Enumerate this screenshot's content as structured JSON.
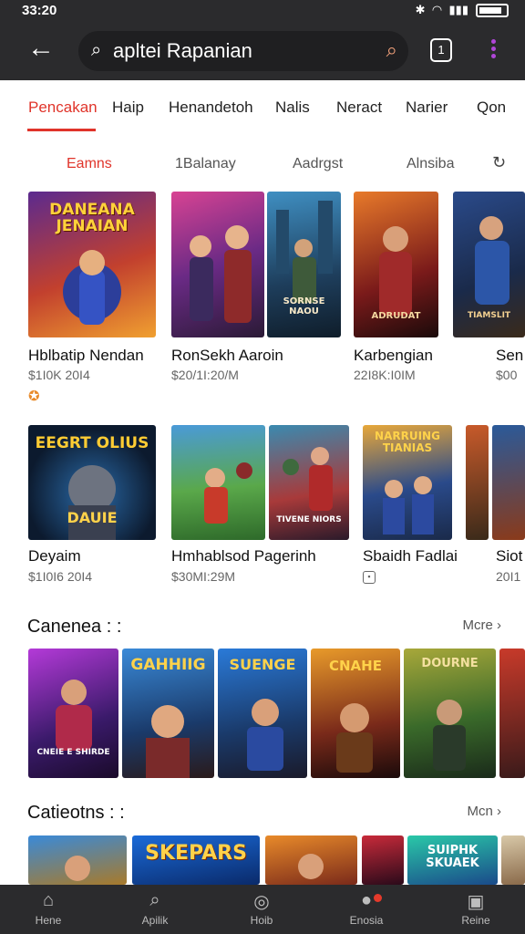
{
  "status_bar": {
    "time": "33:20",
    "icons": [
      "bluetooth-icon",
      "wifi-icon",
      "signal-icon",
      "battery-icon"
    ]
  },
  "app_bar": {
    "search_text": "apltei Rapanian",
    "tabs_count": "1"
  },
  "category_tabs": [
    "Pencakan",
    "Haip",
    "Henandetoh",
    "Nalis",
    "Neract",
    "Narier",
    "Qon"
  ],
  "sub_tabs": [
    "Eamns",
    "1Balanay",
    "Aadrgst",
    "Alnsiba"
  ],
  "row1": [
    {
      "banner": "DANEANA JENAIAN",
      "title": "Hblbatip Nendan",
      "meta": "$1I0K 20I4"
    },
    {
      "banner": "",
      "title": "RonSekh Aaroin",
      "meta": "$20/1I:20/M"
    },
    {
      "banner": "SORNSE NAOU",
      "title": "",
      "meta": ""
    },
    {
      "banner": "ADRUDAT",
      "title": "Karbengian",
      "meta": "22I8K:I0IM"
    },
    {
      "banner": "TIAMSLIT",
      "title": "Sen",
      "meta": "$00"
    }
  ],
  "row2": [
    {
      "banner_top": "EEGRT OLIUS",
      "banner_bottom": "DAUIE",
      "title": "Deyaim",
      "meta": "$1I0I6 20I4"
    },
    {
      "banner": "",
      "title": "Hmhablsod Pagerinh",
      "meta": "$30MI:29M"
    },
    {
      "banner": "TIVENE NIORS",
      "title": "",
      "meta": ""
    },
    {
      "banner": "NARRUING TIANIAS",
      "title": "Sbaidh Fadlai",
      "meta": ""
    },
    {
      "banner": "",
      "title": "Siot",
      "meta": "20I1"
    }
  ],
  "section1": {
    "title": "Canenea : :",
    "more": "Mcre"
  },
  "section1_cards": [
    {
      "banner": "CNEIE E SHIRDE"
    },
    {
      "banner": "GAHHIIG"
    },
    {
      "banner": "SUENGE"
    },
    {
      "banner": "CNAHE"
    },
    {
      "banner": "DOURNE"
    },
    {
      "banner": ""
    }
  ],
  "section2": {
    "title": "Catieotns : :",
    "more": "Mcn"
  },
  "section2_cards": [
    {
      "banner": ""
    },
    {
      "banner": "SKEPARS"
    },
    {
      "banner": ""
    },
    {
      "banner": ""
    },
    {
      "banner": "SUIPHK SKUAEK"
    },
    {
      "banner": ""
    }
  ],
  "bottom_nav": [
    {
      "label": "Hene",
      "icon": "home-icon"
    },
    {
      "label": "Apilik",
      "icon": "search-icon"
    },
    {
      "label": "Hoib",
      "icon": "compass-icon"
    },
    {
      "label": "Enosia",
      "icon": "profile-icon"
    },
    {
      "label": "Reine",
      "icon": "inbox-icon"
    }
  ],
  "colors": {
    "accent": "#e0342a",
    "bar": "#2b2b2d",
    "menu_dot": "#b046d8"
  }
}
